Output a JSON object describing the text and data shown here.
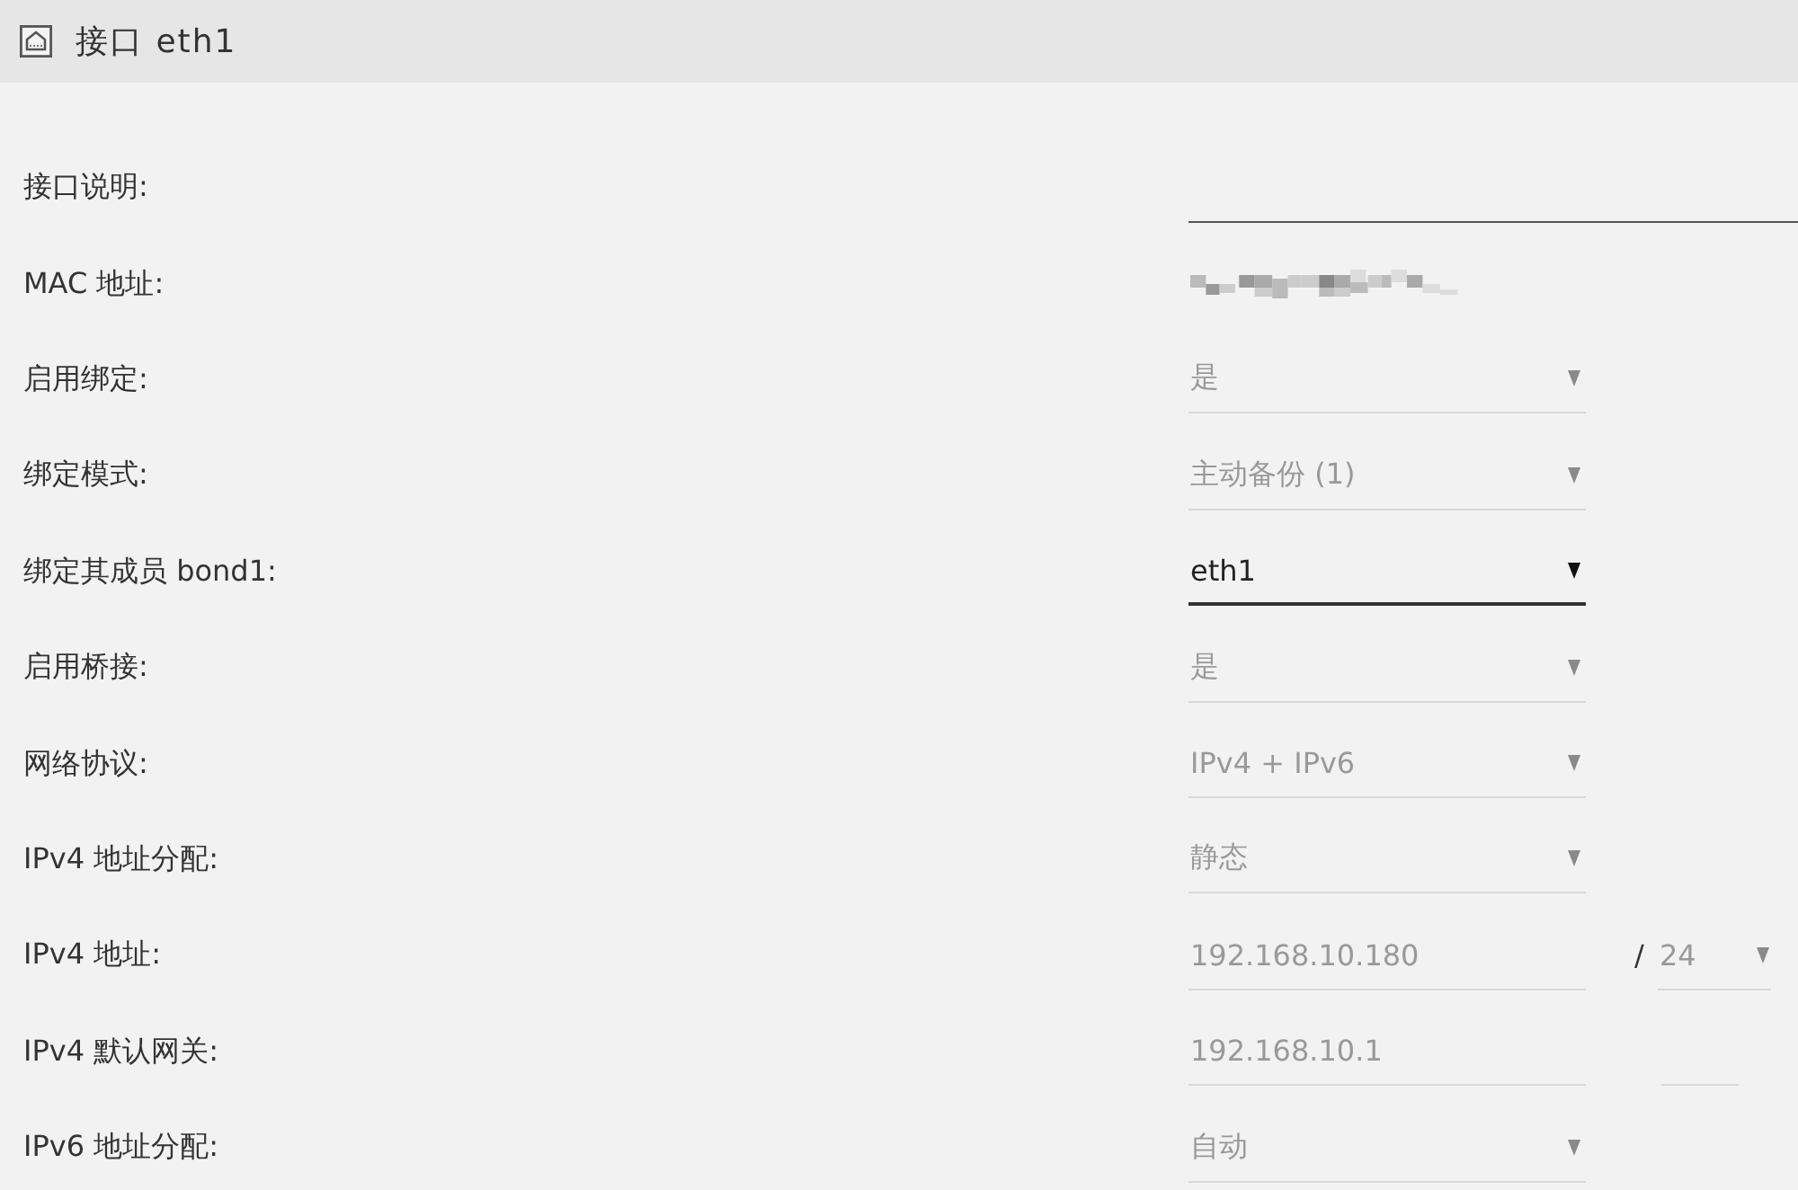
{
  "header": {
    "title": "接口 eth1"
  },
  "fields": [
    {
      "label": "接口说明:",
      "kind": "text",
      "disabled": false
    },
    {
      "label": "MAC 地址:",
      "kind": "redacted"
    },
    {
      "label": "启用绑定:",
      "kind": "select",
      "value": "是",
      "disabled": true
    },
    {
      "label": "绑定模式:",
      "kind": "select",
      "value": "主动备份 (1)",
      "disabled": true
    },
    {
      "label": "绑定其成员 bond1:",
      "kind": "select",
      "value": "eth1",
      "disabled": false
    },
    {
      "label": "启用桥接:",
      "kind": "select",
      "value": "是",
      "disabled": true
    },
    {
      "label": "网络协议:",
      "kind": "select",
      "value": "IPv4 + IPv6",
      "disabled": true
    },
    {
      "label": "IPv4 地址分配:",
      "kind": "select",
      "value": "静态",
      "disabled": true
    },
    {
      "label": "IPv4 地址:",
      "kind": "text",
      "value": "192.168.10.180",
      "disabled": true,
      "extra": {
        "separator": "/",
        "kind": "select",
        "value": "24",
        "disabled": true
      }
    },
    {
      "label": "IPv4 默认网关:",
      "kind": "text",
      "value": "192.168.10.1",
      "disabled": true,
      "extra": {
        "kind": "text",
        "disabled": true
      }
    },
    {
      "label": "IPv6 地址分配:",
      "kind": "select",
      "value": "自动",
      "disabled": true
    }
  ]
}
